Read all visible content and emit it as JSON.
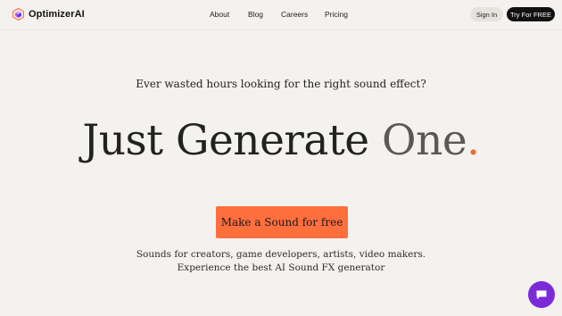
{
  "brand": {
    "name": "OptimizerAI",
    "logo_icon": "hexagon-cube-logo-icon",
    "logo_colors": [
      "#ff6f3e",
      "#a64bf4",
      "#4a3aff"
    ]
  },
  "nav": {
    "links": [
      "About",
      "Blog",
      "Careers",
      "Pricing"
    ],
    "signin_label": "Sign In",
    "try_label": "Try For FREE"
  },
  "hero": {
    "eyebrow": "Ever wasted hours looking for the right sound effect?",
    "headline_part1": "Just Generate ",
    "headline_part2": "One",
    "headline_dot": ".",
    "cta_label": "Make a Sound for free",
    "subtext_line1": "Sounds for creators, game developers, artists, video makers.",
    "subtext_line2": "Experience the best AI Sound FX generator"
  },
  "chat": {
    "icon": "chat-bubble-icon",
    "color": "#7b2ad8"
  },
  "colors": {
    "background": "#f4f2ef",
    "accent": "#ff6f3e",
    "dark_button": "#111111"
  }
}
